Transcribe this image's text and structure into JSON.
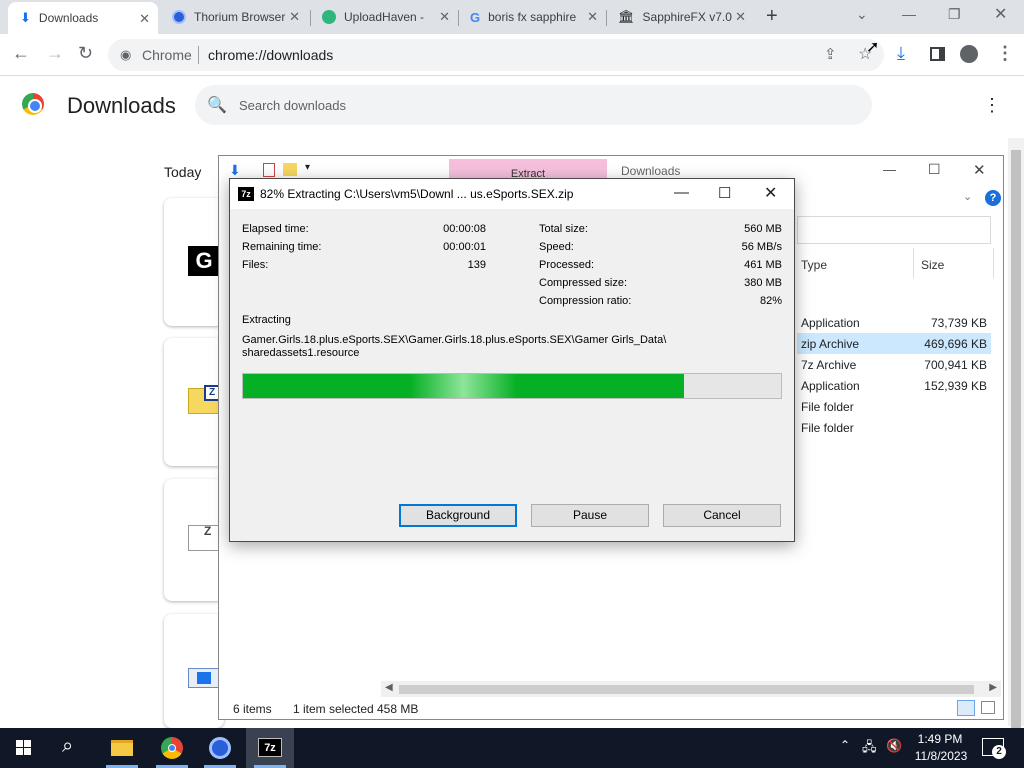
{
  "tabs": [
    {
      "label": "Downloads",
      "icon": "download-icon"
    },
    {
      "label": "Thorium Browser",
      "icon": "thorium-icon"
    },
    {
      "label": "UploadHaven -",
      "icon": "uploadhaven-icon"
    },
    {
      "label": "boris fx sapphire",
      "icon": "google-icon"
    },
    {
      "label": "SapphireFX v7.0",
      "icon": "site-icon"
    }
  ],
  "toolbar": {
    "site_label": "Chrome",
    "url": "chrome://downloads"
  },
  "downloads_page": {
    "title": "Downloads",
    "search_placeholder": "Search downloads",
    "section_today": "Today"
  },
  "explorer": {
    "extract_tab": "Extract",
    "title": "Downloads",
    "columns": {
      "type": "Type",
      "size": "Size"
    },
    "rows": [
      {
        "type": "Application",
        "size": "73,739 KB",
        "selected": false
      },
      {
        "type": "zip Archive",
        "size": "469,696 KB",
        "selected": true
      },
      {
        "type": "7z Archive",
        "size": "700,941 KB",
        "selected": false
      },
      {
        "type": "Application",
        "size": "152,939 KB",
        "selected": false
      },
      {
        "type": "File folder",
        "size": "",
        "selected": false
      },
      {
        "type": "File folder",
        "size": "",
        "selected": false
      }
    ],
    "status": {
      "items": "6 items",
      "selected": "1 item selected",
      "size": "458 MB"
    }
  },
  "zip_dialog": {
    "app_icon": "7z",
    "title": "82% Extracting C:\\Users\\vm5\\Downl ... us.eSports.SEX.zip",
    "left_stats": [
      {
        "label": "Elapsed time:",
        "value": "00:00:08"
      },
      {
        "label": "Remaining time:",
        "value": "00:00:01"
      },
      {
        "label": "Files:",
        "value": "139"
      }
    ],
    "right_stats": [
      {
        "label": "Total size:",
        "value": "560 MB"
      },
      {
        "label": "Speed:",
        "value": "56 MB/s"
      },
      {
        "label": "Processed:",
        "value": "461 MB"
      },
      {
        "label": "Compressed size:",
        "value": "380 MB"
      },
      {
        "label": "Compression ratio:",
        "value": "82%"
      }
    ],
    "operation": "Extracting",
    "path_line1": "Gamer.Girls.18.plus.eSports.SEX\\Gamer.Girls.18.plus.eSports.SEX\\Gamer Girls_Data\\",
    "path_line2": "sharedassets1.resource",
    "progress_fraction": 0.82,
    "buttons": {
      "background": "Background",
      "pause": "Pause",
      "cancel": "Cancel"
    }
  },
  "taskbar": {
    "apps": [
      "start-icon",
      "search-icon",
      "file-explorer-icon",
      "chrome-icon",
      "thorium-icon",
      "7zip-icon"
    ],
    "time": "1:49 PM",
    "date": "11/8/2023",
    "notification_count": "2"
  },
  "colors": {
    "progress_green": "#06b025",
    "chrome_tabstrip": "#dee1e6",
    "selection_blue": "#cce8ff",
    "extract_pink": "#f6c0dc",
    "taskbar": "#101828"
  }
}
